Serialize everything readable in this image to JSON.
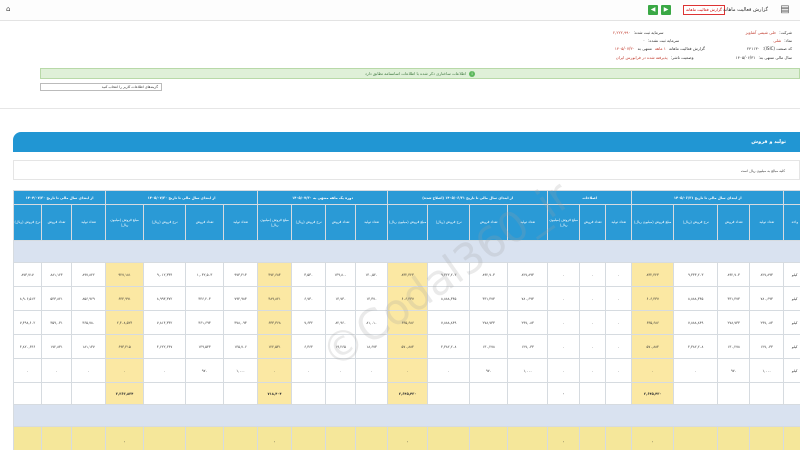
{
  "topbar": {
    "title": "گزارش فعالیت ماهانه",
    "report_button": "گزارش فعالیت ماهانه",
    "nav_prev": "◀",
    "nav_next": "▶",
    "home_icon": "home-icon",
    "logo_icon": "document-icon"
  },
  "company": {
    "name_label": "شرکت:",
    "name_value": "حلی شیمی آشاویز",
    "symbol_label": "نماد:",
    "symbol_value": "شلی",
    "code_label": "کد صنعت (ISIC):",
    "code_value": "۲۴۱۱۳۰",
    "period_label": "سال مالی منتهی به:",
    "period_value": "۱۴۰۵/۰۶/۳۱",
    "capital_label": "سرمایه ثبت شده:",
    "capital_value": "۲,۲۲۲,۹۹۰",
    "unregistered_capital_label": "سرمایه ثبت نشده:",
    "unregistered_capital_value": "۰",
    "report_label": "گزارش فعالیت ماهانه",
    "months_label": "۱ ماهه",
    "ending_label": "منتهی به",
    "ending_value": "۱۴۰۵/۰۷/۳۰",
    "status_label": "وضعیت ناشر:",
    "status_value": "پذیرفته شده در فرابورس ایران"
  },
  "alert": {
    "text": "اطلاعات ساختاری ذکر شده با اطلاعات اساسنامه تطابق دارد"
  },
  "select": {
    "value": "گزینه‌های اطلاعات کاربر را انتخاب کنید"
  },
  "section": {
    "title": "تولید و فروش",
    "note": "کلیه مبالغ به میلیون ریال است"
  },
  "table": {
    "group_headers": [
      "شرح",
      "از ابتدای سال مالی تا تاریخ ۱۴۰۵/۰۶/۳۱",
      "اصلاحات",
      "از ابتدای سال مالی تا تاریخ ۱۴۰۵/۰۶/۳۱ (اصلاح شده)",
      "دوره یک ماهه منتهی به ۱۴۰۵/۰۷/۳۰",
      "از ابتدای سال مالی تا تاریخ ۱۴۰۵/۰۷/۳۰",
      "از ابتدای سال مالی تا تاریخ ۱۴۰۴/۰۷/۳۰"
    ],
    "col_headers": [
      "نام محصول",
      "واحد",
      "تعداد تولید",
      "تعداد فروش",
      "نرخ فروش (ریال)",
      "مبلغ فروش (میلیون ریال)",
      "تعداد تولید",
      "تعداد فروش",
      "مبلغ فروش (میلیون ریال)",
      "تعداد تولید",
      "تعداد فروش",
      "نرخ فروش (ریال)",
      "مبلغ فروش (میلیون ریال)",
      "تعداد تولید",
      "تعداد فروش",
      "نرخ فروش (ریال)",
      "مبلغ فروش (میلیون ریال)",
      "تعداد تولید",
      "تعداد فروش",
      "نرخ فروش (ریال)",
      "مبلغ فروش (میلیون ریال)",
      "تعداد تولید",
      "تعداد فروش",
      "نرخ فروش (ریال)"
    ],
    "group1_label": "فروش داخلی:",
    "rows": [
      {
        "name": "پودر آلومینیوم نیوزه",
        "unit": "کیلو",
        "cells": [
          "۸۲۷,۸۹۳",
          "۸۹۲,۷۰۳",
          "۹,۳۳۳,۲۰۳",
          "۸۳۲,۴۲۳",
          "۰",
          "۰",
          "۰",
          "۸۲۷,۸۹۳",
          "۸۹۲,۷۰۳",
          "۹,۳۲۲,۲۰۳",
          "۸۳۲,۴۲۳",
          "۱۴۰,۵۲۰",
          "۱۳۹,۸۰۰",
          "۳,۵۳۰",
          "۴۷۲,۶۸۴",
          "۹۷۳,۴۱۳",
          "۱,۰۳۲,۵۰۳",
          "۹,۰۱۲,۳۴۴",
          "۹۲۷,۱۸۱",
          "۸۹۷,۸۲۲",
          "۸۸۱,۱۲۴",
          "۸۷۳,۷۱۷"
        ]
      },
      {
        "name": "سولفات منیزیم",
        "unit": "کیلو",
        "cells": [
          "۷۸۰,۶۹۳",
          "۴۳۱,۴۷۳",
          "۸,۸۸۸,۳۴۵",
          "۶۰۶,۴۳۷",
          "۰",
          "۰",
          "۰",
          "۷۸۰,۶۹۳",
          "۴۳۱,۴۷۳",
          "۸,۸۸۸,۳۴۵",
          "۶۰۶,۴۳۷",
          "۱۴,۳۷۰",
          "۱۴,۷۳۰",
          "۶,۷۳۰",
          "۴۸۹,۸۲۱",
          "۷۹۴,۹۸۳",
          "۴۴۶,۲۰۳",
          "۸,۹۹۳,۳۷۲",
          "۶۴۴,۹۹۱",
          "۸۵۶,۹۶۹",
          "۵۴۳,۸۲۱",
          "۸,۹۰۶,۵۱۳"
        ]
      },
      {
        "name": "سولفات روی",
        "unit": "کیلو",
        "cells": [
          "۲۹۷,۰۸۳",
          "۲۷۸,۷۳۳",
          "۷,۸۸۸,۸۴۹",
          "۶۳۵,۶۸۶",
          "۰",
          "۰",
          "۰",
          "۲۹۷,۰۸۳",
          "۲۷۸,۷۳۳",
          "۷,۸۸۸,۸۴۹",
          "۶۳۵,۶۸۶",
          "۸۱,۰۱۰",
          "۸۲,۹۶۰",
          "۷,۶۳۲",
          "۶۳۳,۳۶۸",
          "۳۷۸,۰۹۳",
          "۳۶۱,۶۹۳",
          "۷,۸۱۴,۳۴۲",
          "۲,۴۰۸,۵۲۴",
          "۳۶۵,۷۸۰",
          "۳۵۹,۰۳۱",
          "۷,۴۹۸,۶۰۲"
        ]
      },
      {
        "name": "سایر (خام معدنی)",
        "unit": "کیلو",
        "cells": [
          "۱۲۷,۰۳۳",
          "۱۳۰,۲۷۸",
          "۴,۳۸۲,۲۰۸",
          "۵۷۰,۸۸۴",
          "۰",
          "۰",
          "۰",
          "۱۲۷,۰۳۳",
          "۱۳۰,۲۷۸",
          "۴,۳۸۲,۲۰۸",
          "۵۷۰,۸۸۴",
          "۱۸,۶۷۳",
          "۱۹,۲۶۵",
          "۶,۳۶۴",
          "۱۲۲,۵۳۱",
          "۱۴۵,۷۰۶",
          "۱۴۹,۵۴۳",
          "۴,۶۲۲,۶۴۷",
          "۶۹۳,۴۱۵",
          "۱۸۱,۱۳۷",
          "۱۷۲,۸۳۱",
          "۴,۸۲۰,۶۳۶"
        ]
      },
      {
        "name": "سایر",
        "unit": "کیلو",
        "cells": [
          "۱,۰۰۰",
          "۹۷۰",
          "۰",
          "۰",
          "۰",
          "۰",
          "۰",
          "۱,۰۰۰",
          "۹۷۰",
          "۰",
          "۰",
          "۰",
          "۰",
          "۰",
          "۰",
          "۱,۰۰۰",
          "۹۷۰",
          "۰",
          "۰",
          "۰",
          "۰",
          "۰"
        ]
      }
    ],
    "sum_label": "جمع فروش داخلی",
    "sum_cells": [
      "",
      "",
      "",
      "۲,۶۴۵,۴۳۰",
      "",
      "",
      "۰",
      "",
      "",
      "",
      "۲,۶۴۵,۴۳۰",
      "",
      "",
      "",
      "۷۱۸,۴۰۴",
      "",
      "",
      "",
      "۳,۳۶۳,۸۳۴",
      "",
      "",
      ""
    ],
    "group2_label": "فروش صادراتی:",
    "sum2_cells": [
      "",
      "",
      "",
      "۰",
      "",
      "",
      "۰",
      "",
      "",
      "",
      "۰",
      "",
      "",
      "",
      "۰",
      "",
      "",
      "",
      "۰",
      "",
      "",
      ""
    ]
  },
  "watermark": "©Codal360_ir"
}
